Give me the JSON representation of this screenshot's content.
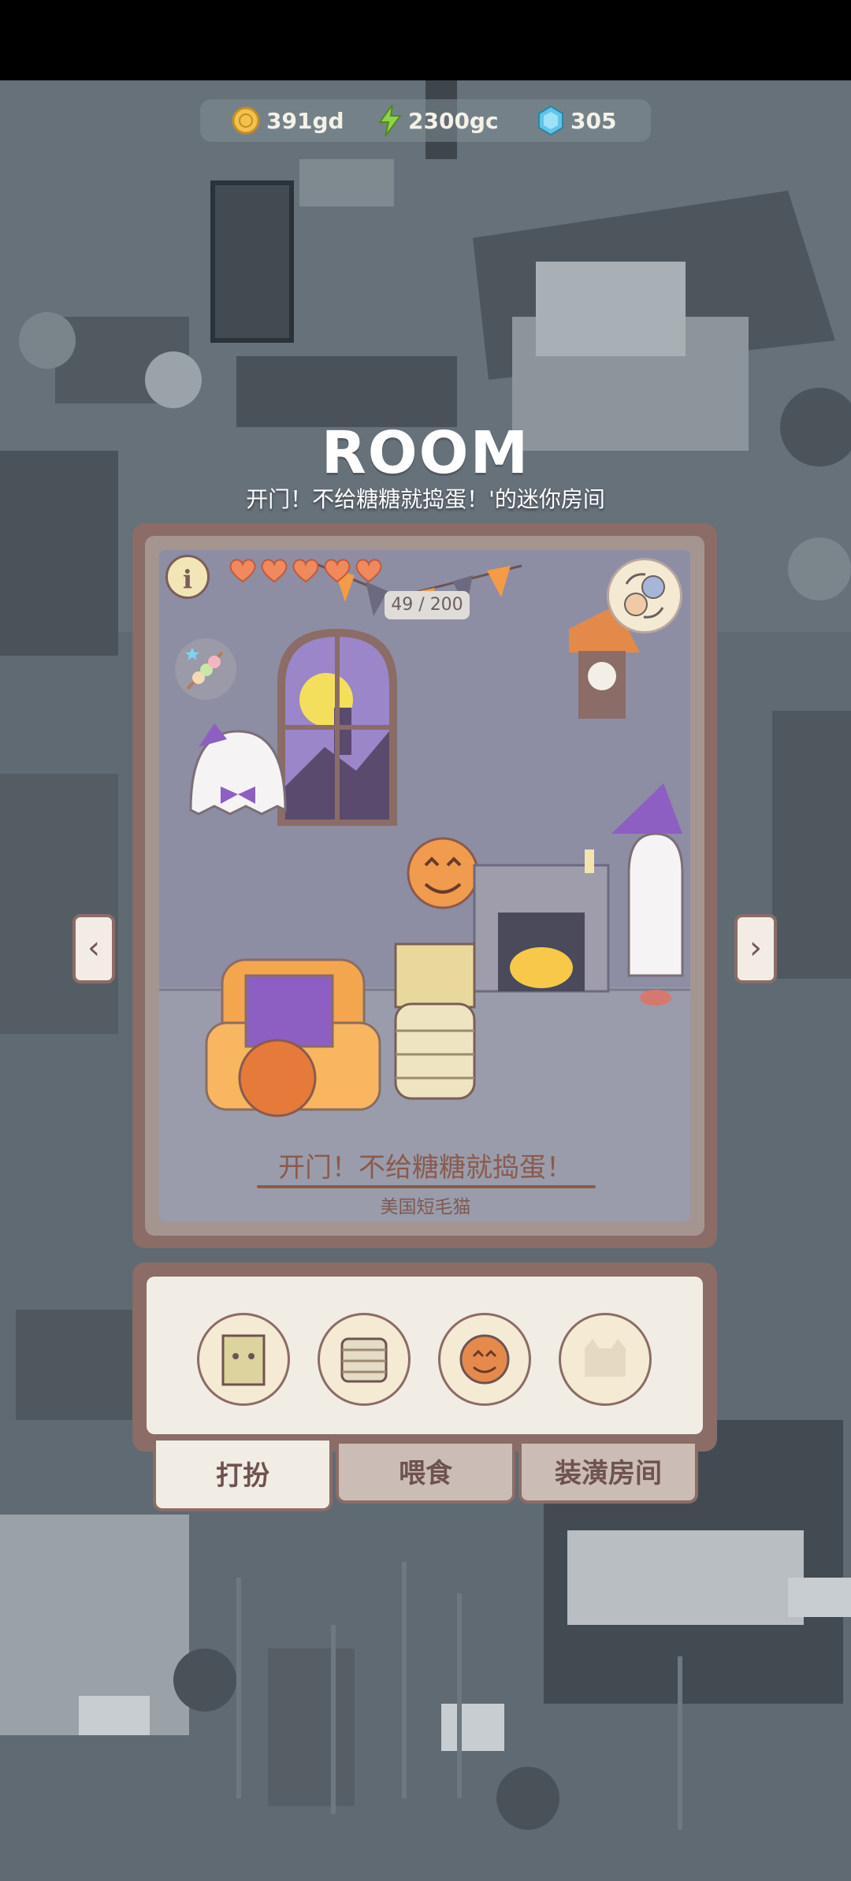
{
  "currency": {
    "gold": "391gd",
    "energy": "2300gc",
    "gems": "305"
  },
  "header": {
    "title": "ROOM",
    "subtitle": "开门！不给糖糖就捣蛋！'的迷你房间"
  },
  "room": {
    "info_icon": "i",
    "hearts_filled": 5,
    "hearts_total": 5,
    "affection": "49 / 200",
    "cat_outfit_name": "开门！不给糖糖就捣蛋！",
    "cat_breed": "美国短毛猫"
  },
  "nav": {
    "prev": "‹",
    "next": "›"
  },
  "items": [
    {
      "icon": "paper-bag-mask-icon"
    },
    {
      "icon": "mummy-wrap-icon"
    },
    {
      "icon": "pumpkin-cookie-icon"
    },
    {
      "icon": "locked-cat-silhouette-icon"
    }
  ],
  "tabs": {
    "dress_up": "打扮",
    "feed": "喂食",
    "decorate": "装潢房间"
  },
  "colors": {
    "frame": "#8b6c66",
    "panel_bg": "#f1ede5",
    "heart": "#f08a5d",
    "text_brown": "#8b5a4e"
  }
}
